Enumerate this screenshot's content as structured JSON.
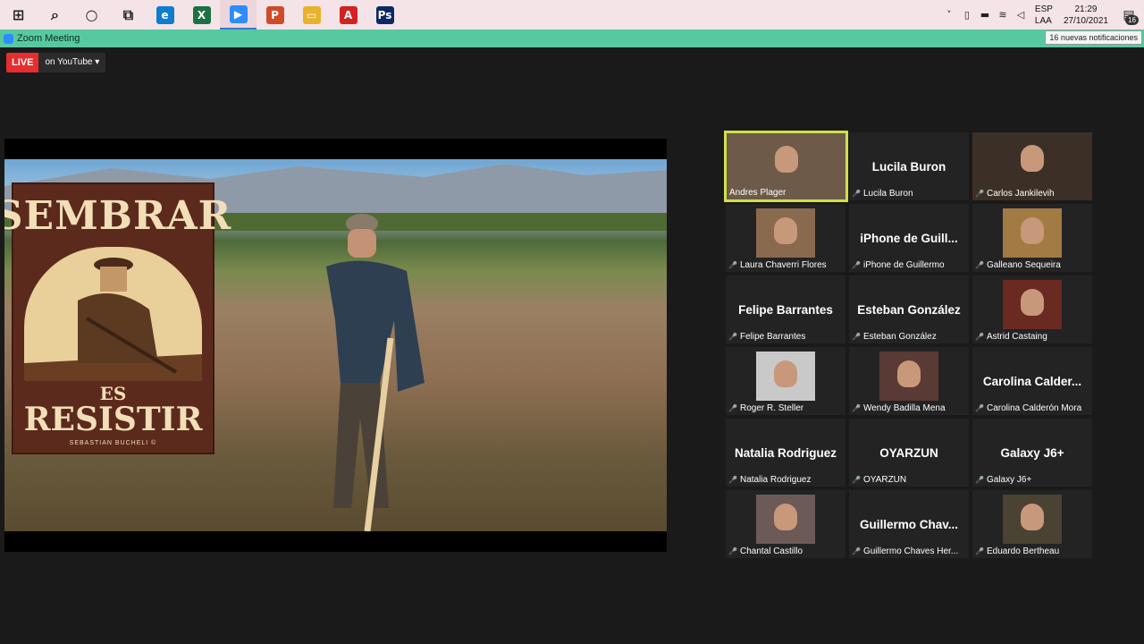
{
  "taskbar": {
    "apps": [
      {
        "name": "start-button",
        "glyph": "⊞",
        "color": "#1e1e1e"
      },
      {
        "name": "search-icon",
        "glyph": "⌕",
        "color": "#1e1e1e"
      },
      {
        "name": "cortana-icon",
        "glyph": "○",
        "color": "#1e1e1e"
      },
      {
        "name": "task-view-icon",
        "glyph": "⧉",
        "color": "#1e1e1e"
      },
      {
        "name": "edge-icon",
        "glyph": "e",
        "color": "#0f7bd1"
      },
      {
        "name": "excel-icon",
        "glyph": "X",
        "color": "#1d7044"
      },
      {
        "name": "zoom-icon",
        "glyph": "▶",
        "color": "#2d8cff"
      },
      {
        "name": "powerpoint-icon",
        "glyph": "P",
        "color": "#d04a28"
      },
      {
        "name": "file-explorer-icon",
        "glyph": "▭",
        "color": "#e8b22c"
      },
      {
        "name": "acrobat-icon",
        "glyph": "A",
        "color": "#d32222"
      },
      {
        "name": "photoshop-icon",
        "glyph": "Ps",
        "color": "#0b2a63"
      }
    ],
    "lang_line1": "ESP",
    "lang_line2": "LAA",
    "time": "21:29",
    "date": "27/10/2021",
    "notif_count": "16"
  },
  "window": {
    "title": "Zoom Meeting",
    "tooltip": "16 nuevas notificaciones"
  },
  "live": {
    "badge": "LIVE",
    "platform": "on YouTube ▾"
  },
  "poster": {
    "title": "SEMBRAR",
    "es": "ES",
    "resistir": "RESISTIR",
    "author": "SEBASTIAN BUCHELI ©"
  },
  "participants": [
    {
      "name": "Andres Plager",
      "big": "",
      "video": true,
      "active": true,
      "bg": "#6d5a48"
    },
    {
      "name": "Lucila Buron",
      "big": "Lucila Buron",
      "video": false
    },
    {
      "name": "Carlos Jankilevih",
      "big": "",
      "video": true,
      "bg": "#3c3026"
    },
    {
      "name": "Laura Chaverri Flores",
      "big": "",
      "video": true,
      "bg": "#8a6a4e"
    },
    {
      "name": "iPhone de Guillermo",
      "big": "iPhone de Guill...",
      "video": false
    },
    {
      "name": "Galleano Sequeira",
      "big": "",
      "video": true,
      "bg": "#a27a44"
    },
    {
      "name": "Felipe Barrantes",
      "big": "Felipe Barrantes",
      "video": false
    },
    {
      "name": "Esteban González",
      "big": "Esteban González",
      "video": false
    },
    {
      "name": "Astrid Castaing",
      "big": "",
      "video": true,
      "bg": "#6a2a22"
    },
    {
      "name": "Roger R. Steller",
      "big": "",
      "video": true,
      "bg": "#c9c9c9"
    },
    {
      "name": "Wendy Badilla Mena",
      "big": "",
      "video": true,
      "bg": "#5a3a34"
    },
    {
      "name": "Carolina Calderón Mora",
      "big": "Carolina Calder...",
      "video": false
    },
    {
      "name": "Natalia Rodriguez",
      "big": "Natalia Rodriguez",
      "video": false
    },
    {
      "name": "OYARZUN",
      "big": "OYARZUN",
      "video": false
    },
    {
      "name": "Galaxy J6+",
      "big": "Galaxy J6+",
      "video": false
    },
    {
      "name": "Chantal Castillo",
      "big": "",
      "video": true,
      "bg": "#6b5a56"
    },
    {
      "name": "Guillermo Chaves Her...",
      "big": "Guillermo Chav...",
      "video": false
    },
    {
      "name": "Eduardo Bertheau",
      "big": "",
      "video": true,
      "bg": "#4a4232"
    }
  ]
}
